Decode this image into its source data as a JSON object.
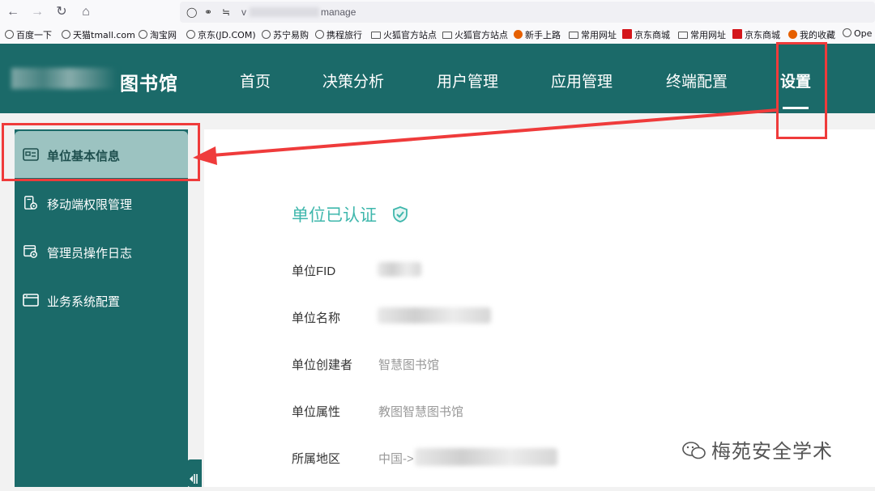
{
  "browser": {
    "url_suffix": "manage",
    "url_prefix": "v",
    "bookmarks": [
      {
        "label": "百度一下",
        "icon": "globe-icon"
      },
      {
        "label": "天猫tmall.com",
        "icon": "globe-icon"
      },
      {
        "label": "淘宝网",
        "icon": "globe-icon"
      },
      {
        "label": "京东(JD.COM)",
        "icon": "globe-icon"
      },
      {
        "label": "苏宁易购",
        "icon": "globe-icon"
      },
      {
        "label": "携程旅行",
        "icon": "globe-icon"
      },
      {
        "label": "火狐官方站点",
        "icon": "folder-icon"
      },
      {
        "label": "火狐官方站点",
        "icon": "folder-icon"
      },
      {
        "label": "新手上路",
        "icon": "firefox-icon"
      },
      {
        "label": "常用网址",
        "icon": "folder-icon"
      },
      {
        "label": "京东商城",
        "icon": "jd-icon"
      },
      {
        "label": "常用网址",
        "icon": "folder-icon"
      },
      {
        "label": "京东商城",
        "icon": "jd-icon"
      },
      {
        "label": "我的收藏",
        "icon": "star-icon"
      },
      {
        "label": "Ope",
        "icon": "globe-icon"
      }
    ]
  },
  "header": {
    "logo_text": "图书馆",
    "nav": [
      "首页",
      "决策分析",
      "用户管理",
      "应用管理",
      "终端配置",
      "设置"
    ],
    "active_nav": "设置"
  },
  "sidebar": {
    "items": [
      {
        "label": "单位基本信息",
        "icon": "id-card-icon",
        "active": true
      },
      {
        "label": "移动端权限管理",
        "icon": "mobile-settings-icon",
        "active": false
      },
      {
        "label": "管理员操作日志",
        "icon": "log-settings-icon",
        "active": false
      },
      {
        "label": "业务系统配置",
        "icon": "window-icon",
        "active": false
      }
    ]
  },
  "main": {
    "cert_title": "单位已认证",
    "rows": [
      {
        "label": "单位FID",
        "value": ""
      },
      {
        "label": "单位名称",
        "value": ""
      },
      {
        "label": "单位创建者",
        "value": "智慧图书馆"
      },
      {
        "label": "单位属性",
        "value": "教图智慧图书馆"
      },
      {
        "label": "所属地区",
        "value": "中国->"
      }
    ]
  },
  "watermark": "梅苑安全学术",
  "colors": {
    "header": "#1b6a69",
    "accent": "#3fb7ac",
    "annotation": "#ef3b3b",
    "sidebar_active": "#9cc3c1"
  }
}
